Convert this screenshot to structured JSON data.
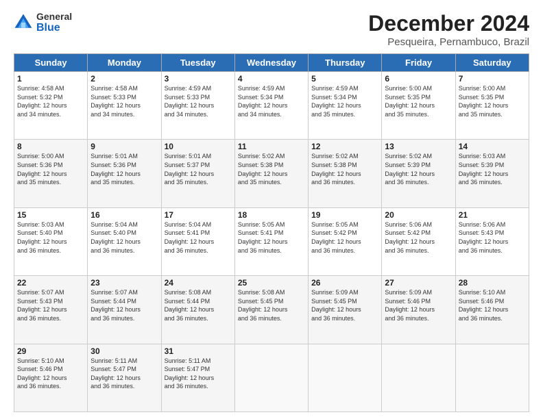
{
  "header": {
    "logo_general": "General",
    "logo_blue": "Blue",
    "month_title": "December 2024",
    "subtitle": "Pesqueira, Pernambuco, Brazil"
  },
  "days_of_week": [
    "Sunday",
    "Monday",
    "Tuesday",
    "Wednesday",
    "Thursday",
    "Friday",
    "Saturday"
  ],
  "weeks": [
    [
      {
        "day": "1",
        "info": "Sunrise: 4:58 AM\nSunset: 5:32 PM\nDaylight: 12 hours\nand 34 minutes."
      },
      {
        "day": "2",
        "info": "Sunrise: 4:58 AM\nSunset: 5:33 PM\nDaylight: 12 hours\nand 34 minutes."
      },
      {
        "day": "3",
        "info": "Sunrise: 4:59 AM\nSunset: 5:33 PM\nDaylight: 12 hours\nand 34 minutes."
      },
      {
        "day": "4",
        "info": "Sunrise: 4:59 AM\nSunset: 5:34 PM\nDaylight: 12 hours\nand 34 minutes."
      },
      {
        "day": "5",
        "info": "Sunrise: 4:59 AM\nSunset: 5:34 PM\nDaylight: 12 hours\nand 35 minutes."
      },
      {
        "day": "6",
        "info": "Sunrise: 5:00 AM\nSunset: 5:35 PM\nDaylight: 12 hours\nand 35 minutes."
      },
      {
        "day": "7",
        "info": "Sunrise: 5:00 AM\nSunset: 5:35 PM\nDaylight: 12 hours\nand 35 minutes."
      }
    ],
    [
      {
        "day": "8",
        "info": "Sunrise: 5:00 AM\nSunset: 5:36 PM\nDaylight: 12 hours\nand 35 minutes."
      },
      {
        "day": "9",
        "info": "Sunrise: 5:01 AM\nSunset: 5:36 PM\nDaylight: 12 hours\nand 35 minutes."
      },
      {
        "day": "10",
        "info": "Sunrise: 5:01 AM\nSunset: 5:37 PM\nDaylight: 12 hours\nand 35 minutes."
      },
      {
        "day": "11",
        "info": "Sunrise: 5:02 AM\nSunset: 5:38 PM\nDaylight: 12 hours\nand 35 minutes."
      },
      {
        "day": "12",
        "info": "Sunrise: 5:02 AM\nSunset: 5:38 PM\nDaylight: 12 hours\nand 36 minutes."
      },
      {
        "day": "13",
        "info": "Sunrise: 5:02 AM\nSunset: 5:39 PM\nDaylight: 12 hours\nand 36 minutes."
      },
      {
        "day": "14",
        "info": "Sunrise: 5:03 AM\nSunset: 5:39 PM\nDaylight: 12 hours\nand 36 minutes."
      }
    ],
    [
      {
        "day": "15",
        "info": "Sunrise: 5:03 AM\nSunset: 5:40 PM\nDaylight: 12 hours\nand 36 minutes."
      },
      {
        "day": "16",
        "info": "Sunrise: 5:04 AM\nSunset: 5:40 PM\nDaylight: 12 hours\nand 36 minutes."
      },
      {
        "day": "17",
        "info": "Sunrise: 5:04 AM\nSunset: 5:41 PM\nDaylight: 12 hours\nand 36 minutes."
      },
      {
        "day": "18",
        "info": "Sunrise: 5:05 AM\nSunset: 5:41 PM\nDaylight: 12 hours\nand 36 minutes."
      },
      {
        "day": "19",
        "info": "Sunrise: 5:05 AM\nSunset: 5:42 PM\nDaylight: 12 hours\nand 36 minutes."
      },
      {
        "day": "20",
        "info": "Sunrise: 5:06 AM\nSunset: 5:42 PM\nDaylight: 12 hours\nand 36 minutes."
      },
      {
        "day": "21",
        "info": "Sunrise: 5:06 AM\nSunset: 5:43 PM\nDaylight: 12 hours\nand 36 minutes."
      }
    ],
    [
      {
        "day": "22",
        "info": "Sunrise: 5:07 AM\nSunset: 5:43 PM\nDaylight: 12 hours\nand 36 minutes."
      },
      {
        "day": "23",
        "info": "Sunrise: 5:07 AM\nSunset: 5:44 PM\nDaylight: 12 hours\nand 36 minutes."
      },
      {
        "day": "24",
        "info": "Sunrise: 5:08 AM\nSunset: 5:44 PM\nDaylight: 12 hours\nand 36 minutes."
      },
      {
        "day": "25",
        "info": "Sunrise: 5:08 AM\nSunset: 5:45 PM\nDaylight: 12 hours\nand 36 minutes."
      },
      {
        "day": "26",
        "info": "Sunrise: 5:09 AM\nSunset: 5:45 PM\nDaylight: 12 hours\nand 36 minutes."
      },
      {
        "day": "27",
        "info": "Sunrise: 5:09 AM\nSunset: 5:46 PM\nDaylight: 12 hours\nand 36 minutes."
      },
      {
        "day": "28",
        "info": "Sunrise: 5:10 AM\nSunset: 5:46 PM\nDaylight: 12 hours\nand 36 minutes."
      }
    ],
    [
      {
        "day": "29",
        "info": "Sunrise: 5:10 AM\nSunset: 5:46 PM\nDaylight: 12 hours\nand 36 minutes."
      },
      {
        "day": "30",
        "info": "Sunrise: 5:11 AM\nSunset: 5:47 PM\nDaylight: 12 hours\nand 36 minutes."
      },
      {
        "day": "31",
        "info": "Sunrise: 5:11 AM\nSunset: 5:47 PM\nDaylight: 12 hours\nand 36 minutes."
      },
      {
        "day": "",
        "info": ""
      },
      {
        "day": "",
        "info": ""
      },
      {
        "day": "",
        "info": ""
      },
      {
        "day": "",
        "info": ""
      }
    ]
  ]
}
